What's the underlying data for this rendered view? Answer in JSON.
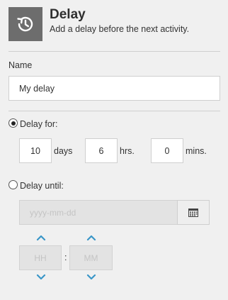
{
  "header": {
    "icon": "clock-rewind-icon",
    "title": "Delay",
    "subtitle": "Add a delay before the next activity."
  },
  "name_field": {
    "label": "Name",
    "value": "My delay"
  },
  "delay_for": {
    "label": "Delay for:",
    "selected": true,
    "days_value": "10",
    "days_unit": "days",
    "hours_value": "6",
    "hours_unit": "hrs.",
    "minutes_value": "0",
    "minutes_unit": "mins."
  },
  "delay_until": {
    "label": "Delay until:",
    "selected": false,
    "date_placeholder": "yyyy-mm-dd",
    "calendar_icon": "calendar-icon",
    "hour_placeholder": "HH",
    "minute_placeholder": "MM",
    "separator": ":",
    "up_icon": "chevron-up-icon",
    "down_icon": "chevron-down-icon"
  },
  "colors": {
    "accent": "#3a96c8",
    "header_icon_bg": "#6d6d6d",
    "disabled_bg": "#e3e3e3"
  }
}
